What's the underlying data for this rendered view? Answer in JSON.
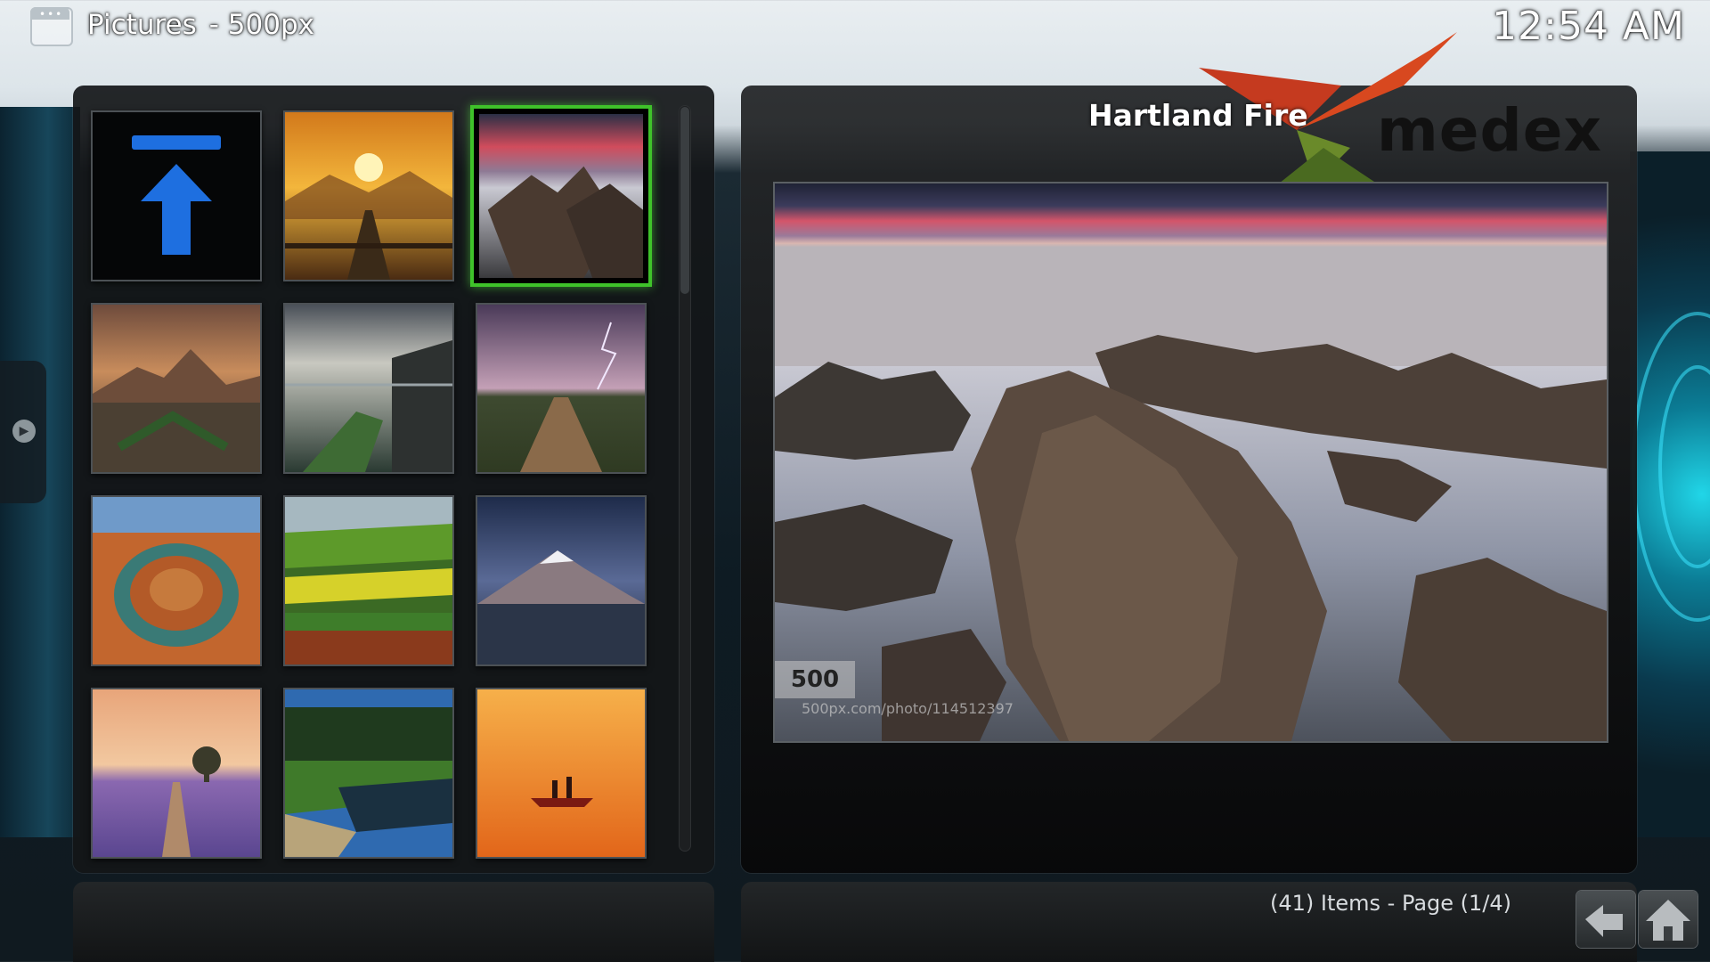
{
  "header": {
    "section": "Pictures",
    "addon": "- 500px",
    "icon": "kodi-window-icon",
    "clock": "12:54 AM"
  },
  "preview": {
    "title": "Hartland Fire",
    "watermark": "500",
    "source_url": "500px.com/photo/114512397"
  },
  "skin_logo": "medex",
  "status": {
    "items_text": "(41) Items - Page (1/4)"
  },
  "grid": {
    "items": [
      {
        "name": "parent-folder",
        "icon": "up-arrow-icon"
      },
      {
        "name": "sunset-pier"
      },
      {
        "name": "hartland-fire"
      },
      {
        "name": "mountain-lake-reflection"
      },
      {
        "name": "rocky-coast-stream"
      },
      {
        "name": "lightning-road"
      },
      {
        "name": "horseshoe-bend"
      },
      {
        "name": "green-fields"
      },
      {
        "name": "snowy-mountain-night"
      },
      {
        "name": "lavender-field-tree"
      },
      {
        "name": "forest-river"
      },
      {
        "name": "orange-lake-boat"
      }
    ],
    "selected_index": 2
  },
  "nav": {
    "back_icon": "back-arrow-icon",
    "home_icon": "home-icon"
  },
  "colors": {
    "selection": "#3fc22a",
    "up_arrow": "#1e6fe0"
  }
}
